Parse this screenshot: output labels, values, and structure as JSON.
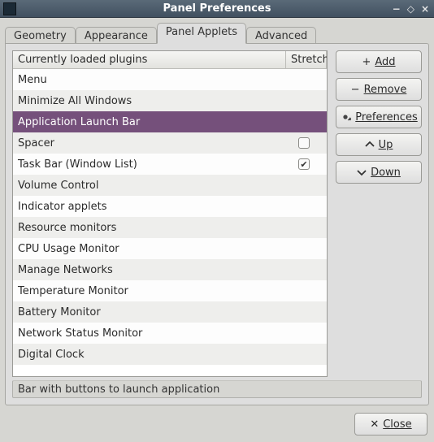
{
  "window": {
    "title": "Panel Preferences"
  },
  "tabs": [
    "Geometry",
    "Appearance",
    "Panel Applets",
    "Advanced"
  ],
  "active_tab": 2,
  "list": {
    "headers": {
      "name": "Currently loaded plugins",
      "stretch": "Stretch"
    },
    "rows": [
      {
        "name": "Menu",
        "stretch": null,
        "selected": false
      },
      {
        "name": "Minimize All Windows",
        "stretch": null,
        "selected": false
      },
      {
        "name": "Application Launch Bar",
        "stretch": null,
        "selected": true
      },
      {
        "name": "Spacer",
        "stretch": false,
        "selected": false
      },
      {
        "name": "Task Bar (Window List)",
        "stretch": true,
        "selected": false
      },
      {
        "name": "Volume Control",
        "stretch": null,
        "selected": false
      },
      {
        "name": "Indicator applets",
        "stretch": null,
        "selected": false
      },
      {
        "name": "Resource monitors",
        "stretch": null,
        "selected": false
      },
      {
        "name": "CPU Usage Monitor",
        "stretch": null,
        "selected": false
      },
      {
        "name": "Manage Networks",
        "stretch": null,
        "selected": false
      },
      {
        "name": "Temperature Monitor",
        "stretch": null,
        "selected": false
      },
      {
        "name": "Battery Monitor",
        "stretch": null,
        "selected": false
      },
      {
        "name": "Network Status Monitor",
        "stretch": null,
        "selected": false
      },
      {
        "name": "Digital Clock",
        "stretch": null,
        "selected": false
      }
    ]
  },
  "buttons": {
    "add": "Add",
    "remove": "Remove",
    "preferences": "Preferences",
    "up": "Up",
    "down": "Down",
    "close": "Close"
  },
  "status": "Bar with buttons to launch application"
}
